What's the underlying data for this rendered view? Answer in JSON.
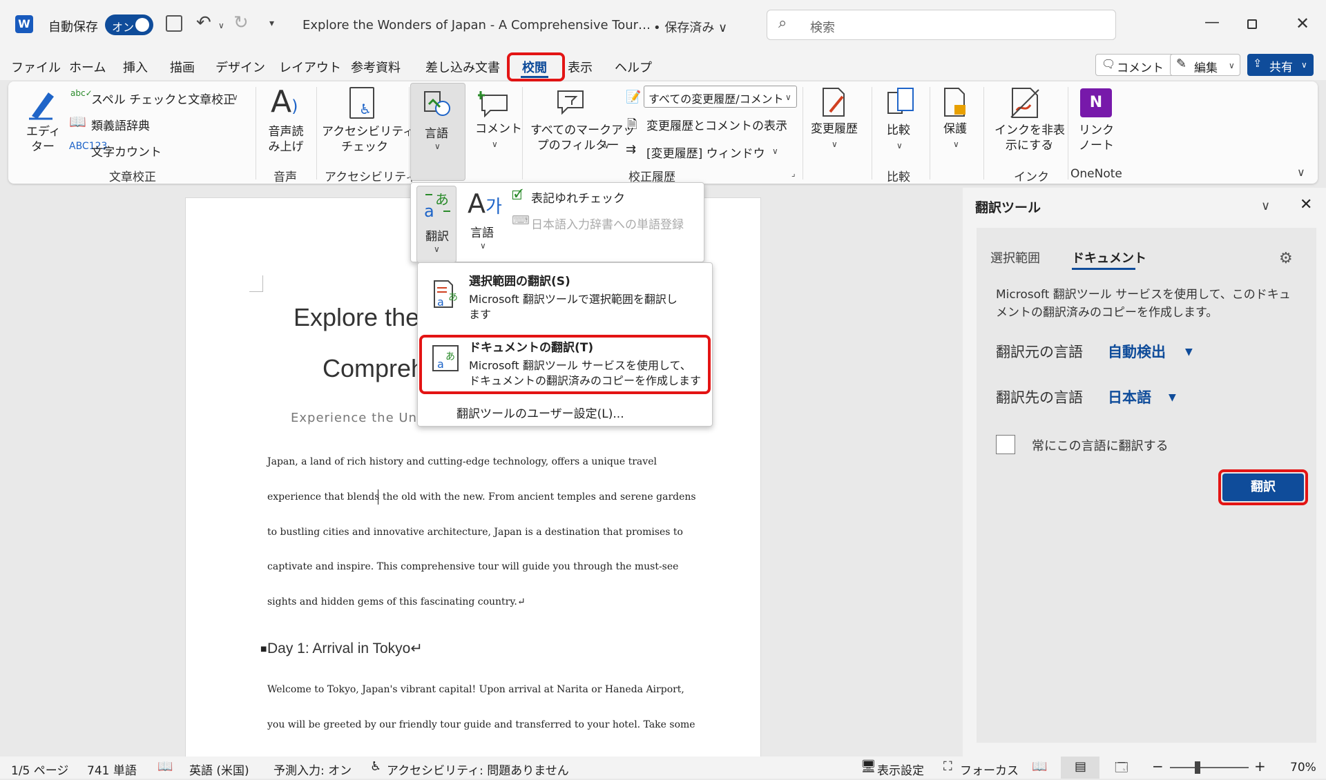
{
  "titlebar": {
    "autosave_label": "自動保存",
    "autosave_state": "オン",
    "doc_title": "Explore the Wonders of Japan - A Comprehensive Tour…",
    "save_state": "• 保存済み ∨",
    "search_placeholder": "検索"
  },
  "tabs": [
    "ファイル",
    "ホーム",
    "挿入",
    "描画",
    "デザイン",
    "レイアウト",
    "参考資料",
    "差し込み文書",
    "校閲",
    "表示",
    "ヘルプ"
  ],
  "top_buttons": {
    "comment": "コメント",
    "edit": "編集",
    "share": "共有"
  },
  "ribbon": {
    "editor": "エディ\nター",
    "spell": "スペル チェックと文章校正",
    "thesaurus": "類義語辞典",
    "wordcount": "文字カウント",
    "group_proofing": "文章校正",
    "readaloud": "音声読\nみ上げ",
    "group_voice": "音声",
    "accessibility": "アクセシビリティ\nチェック",
    "group_accessibility": "アクセシビリティ",
    "language": "言語",
    "comment": "コメント",
    "markup_filter": "すべてのマークアッ\nプのフィルター",
    "track_select": "すべての変更履歴/コメント",
    "show_markup": "変更履歴とコメントの表示",
    "track_pane": "[変更履歴] ウィンドウ",
    "group_tracking": "校正履歴",
    "changes": "変更履歴",
    "compare": "比較",
    "group_compare": "比較",
    "protect": "保護",
    "ink": "インクを非表\n示にする",
    "group_ink": "インク",
    "linked_notes": "リンク\nノート",
    "group_onenote": "OneNote"
  },
  "language_menu": {
    "translate": "翻訳",
    "language": "言語",
    "consistency": "表記ゆれチェック",
    "ime_dict": "日本語入力辞書への単語登録"
  },
  "translate_menu": {
    "sel_title": "選択範囲の翻訳(S)",
    "sel_desc": "Microsoft 翻訳ツールで選択範囲を翻訳し\nます",
    "doc_title": "ドキュメントの翻訳(T)",
    "doc_desc": "Microsoft 翻訳ツール サービスを使用して、\nドキュメントの翻訳済みのコピーを作成します",
    "prefs": "翻訳ツールのユーザー設定(L)..."
  },
  "document": {
    "title1": "Explore the",
    "title2": "Compreh",
    "subtitle": "Experience the Unic",
    "para1": [
      "Japan, a land of rich history and cutting-edge technology, offers a unique travel",
      "experience that blends the old with the new. From ancient temples and serene gardens",
      "to bustling cities and innovative architecture, Japan is a destination that promises to",
      "captivate and inspire. This comprehensive tour will guide you through the must-see",
      "sights and hidden gems of this fascinating country.↵"
    ],
    "heading": "Day 1: Arrival in Tokyo↵",
    "para2": [
      "Welcome to Tokyo, Japan's vibrant capital! Upon arrival at Narita or Haneda Airport,",
      "you will be greeted by our friendly tour guide and transferred to your hotel. Take some"
    ]
  },
  "pane": {
    "title": "翻訳ツール",
    "tab_selection": "選択範囲",
    "tab_document": "ドキュメント",
    "desc": "Microsoft 翻訳ツール サービスを使用して、このドキュ\nメントの翻訳済みのコピーを作成します。",
    "source_label": "翻訳元の言語",
    "source_value": "自動検出",
    "target_label": "翻訳先の言語",
    "target_value": "日本語",
    "always_label": "常にこの言語に翻訳する",
    "translate_button": "翻訳"
  },
  "status": {
    "page": "1/5 ページ",
    "words": "741 単語",
    "lang": "英語 (米国)",
    "predict": "予測入力: オン",
    "access": "アクセシビリティ: 問題ありません",
    "display": "表示設定",
    "focus": "フォーカス",
    "zoom": "70%"
  },
  "colors": {
    "accent": "#0f4c9a",
    "highlight": "#e31414"
  }
}
